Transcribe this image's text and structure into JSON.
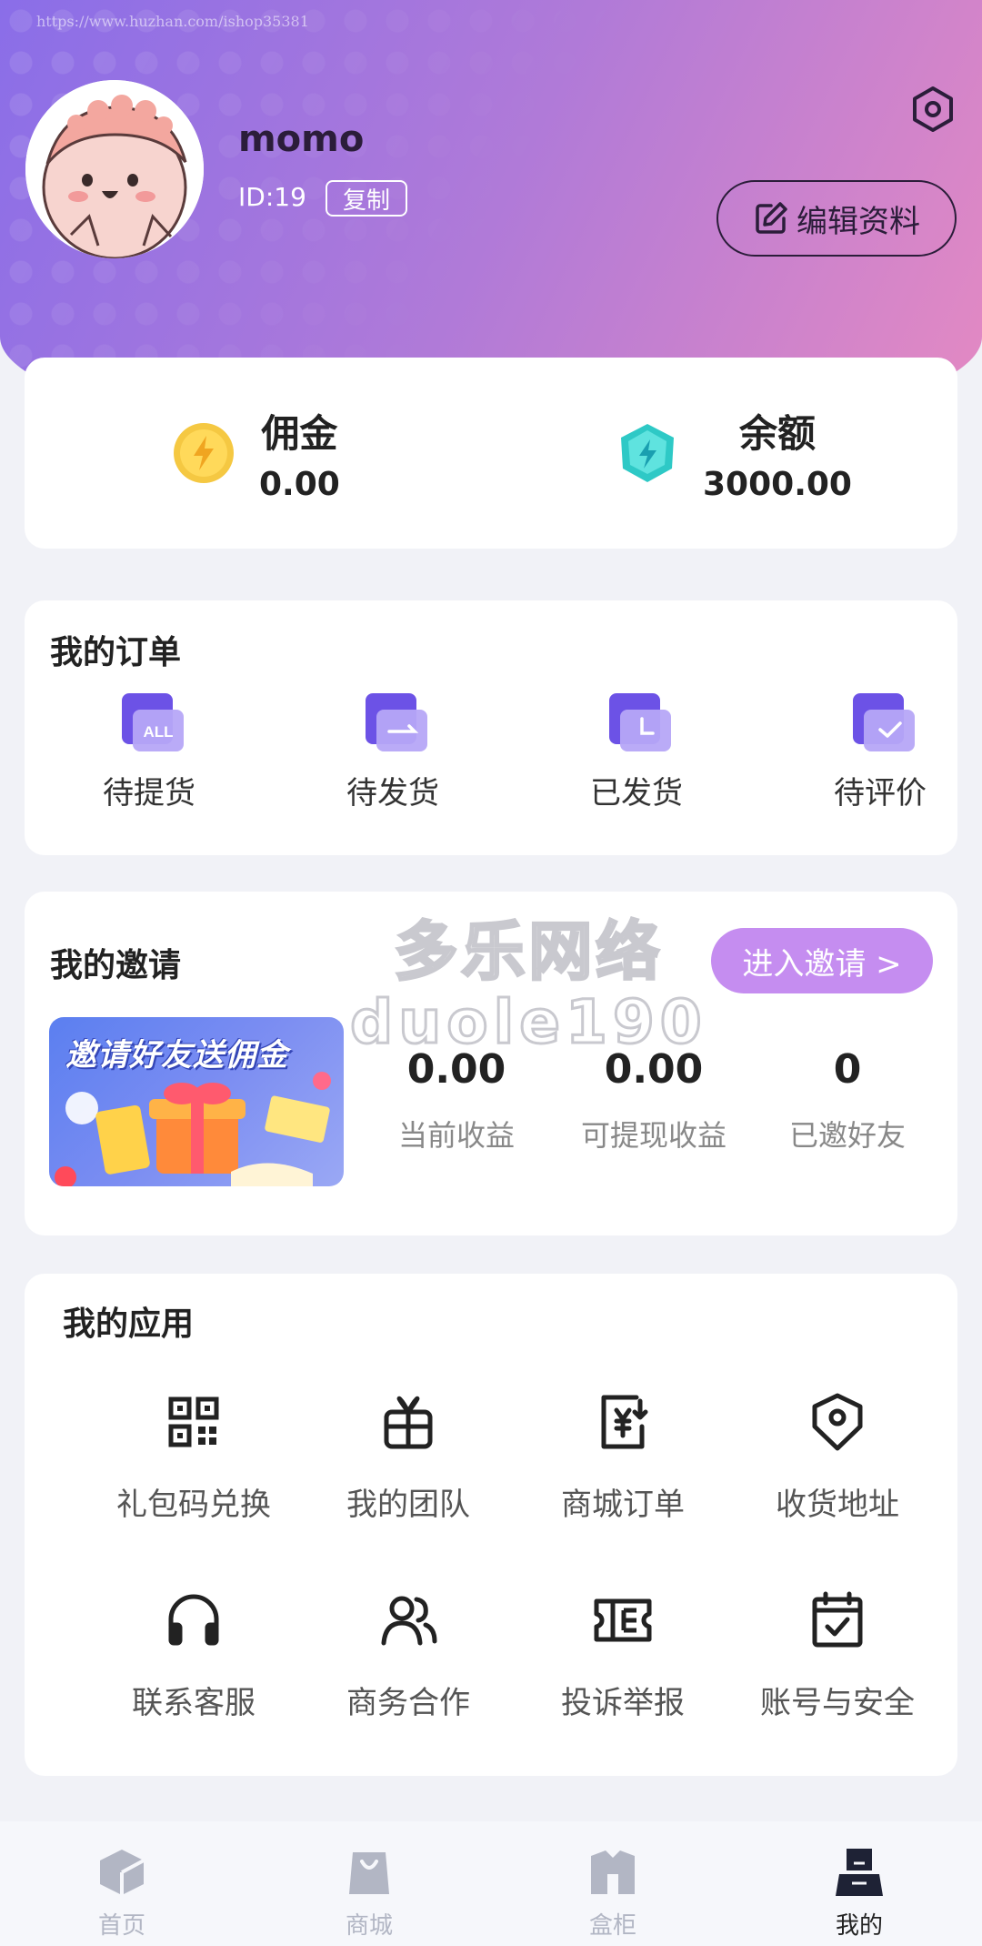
{
  "header": {
    "watermark_url": "https://www.huzhan.com/ishop35381",
    "username": "momo",
    "id_text": "ID:19",
    "copy_label": "复制",
    "edit_label": "编辑资料"
  },
  "balance": {
    "commission_label": "佣金",
    "commission_value": "0.00",
    "balance_label": "余额",
    "balance_value": "3000.00"
  },
  "orders": {
    "title": "我的订单",
    "items": [
      {
        "label": "待提货",
        "icon": "all-orders-icon",
        "badge": "ALL"
      },
      {
        "label": "待发货",
        "icon": "to-ship-icon"
      },
      {
        "label": "已发货",
        "icon": "shipped-clock-icon"
      },
      {
        "label": "待评价",
        "icon": "to-review-check-icon"
      }
    ]
  },
  "invite": {
    "title": "我的邀请",
    "button_label": "进入邀请 >",
    "banner_text": "邀请好友送佣金",
    "stats": [
      {
        "value": "0.00",
        "label": "当前收益"
      },
      {
        "value": "0.00",
        "label": "可提现收益"
      },
      {
        "value": "0",
        "label": "已邀好友"
      }
    ]
  },
  "apps": {
    "title": "我的应用",
    "items": [
      {
        "label": "礼包码兑换",
        "icon": "qr-code-icon"
      },
      {
        "label": "我的团队",
        "icon": "gift-icon"
      },
      {
        "label": "商城订单",
        "icon": "yuan-document-icon"
      },
      {
        "label": "收货地址",
        "icon": "location-shield-icon"
      },
      {
        "label": "联系客服",
        "icon": "headphones-icon"
      },
      {
        "label": "商务合作",
        "icon": "users-icon"
      },
      {
        "label": "投诉举报",
        "icon": "ticket-icon"
      },
      {
        "label": "账号与安全",
        "icon": "calendar-check-icon"
      }
    ]
  },
  "watermark": {
    "line1": "多乐网络",
    "line2": "duole190"
  },
  "tabbar": {
    "items": [
      {
        "label": "首页",
        "icon": "home-cube-icon"
      },
      {
        "label": "商城",
        "icon": "shopping-bag-icon"
      },
      {
        "label": "盒柜",
        "icon": "cabinet-icon"
      },
      {
        "label": "我的",
        "icon": "profile-icon"
      }
    ],
    "active": "我的"
  },
  "colors": {
    "accent": "#c58df0",
    "header_start": "#8a6ee8",
    "header_end": "#e58ac2",
    "order_icon": "#7a5ff0"
  }
}
